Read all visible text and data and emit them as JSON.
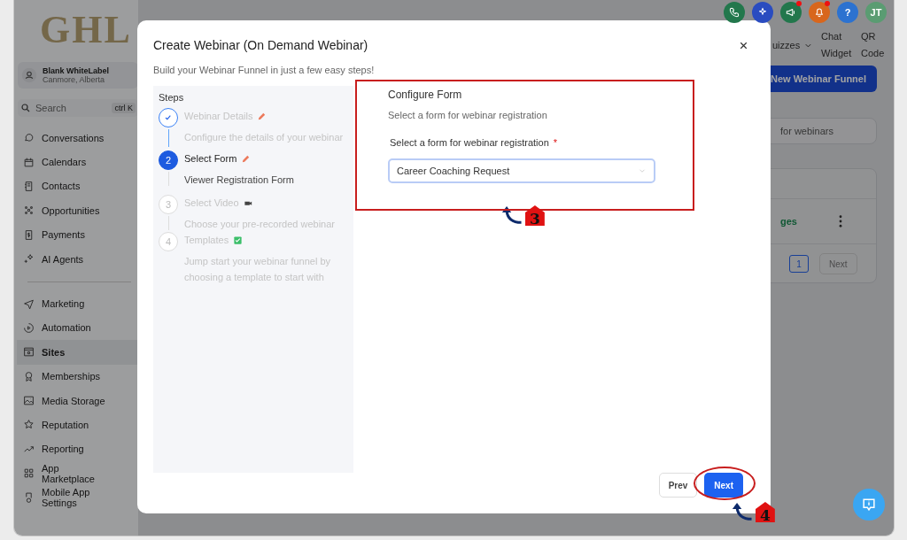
{
  "app": {
    "logo": "GHL",
    "account": {
      "name": "Blank WhiteLabel",
      "location": "Canmore, Alberta"
    },
    "search": {
      "placeholder": "Search",
      "shortcut": "ctrl K"
    },
    "nav_groups": [
      [
        {
          "label": "Conversations",
          "selected": false
        },
        {
          "label": "Calendars",
          "selected": false
        },
        {
          "label": "Contacts",
          "selected": false
        },
        {
          "label": "Opportunities",
          "selected": false
        },
        {
          "label": "Payments",
          "selected": false
        },
        {
          "label": "AI Agents",
          "selected": false
        }
      ],
      [
        {
          "label": "Marketing",
          "selected": false
        },
        {
          "label": "Automation",
          "selected": false
        },
        {
          "label": "Sites",
          "selected": true
        },
        {
          "label": "Memberships",
          "selected": false
        },
        {
          "label": "Media Storage",
          "selected": false
        },
        {
          "label": "Reputation",
          "selected": false
        },
        {
          "label": "Reporting",
          "selected": false
        },
        {
          "label": "App Marketplace",
          "selected": false
        },
        {
          "label": "Mobile App Settings",
          "selected": false
        }
      ]
    ]
  },
  "header": {
    "actions": [
      {
        "kind": "phone",
        "color": "#22774c",
        "badge": false
      },
      {
        "kind": "sparkle",
        "color": "#2a4cc0",
        "badge": false
      },
      {
        "kind": "megaphone",
        "color": "#22774c",
        "badge": true
      },
      {
        "kind": "bell",
        "color": "#d8661c",
        "badge": true
      },
      {
        "kind": "text",
        "label": "?",
        "color": "#2c72d0",
        "badge": false
      },
      {
        "kind": "text",
        "label": "JT",
        "color": "#5a9c72",
        "badge": false
      }
    ],
    "menu": [
      {
        "label": "uizzes",
        "dropdown": true
      },
      {
        "label": "Chat Widget",
        "dropdown": false
      },
      {
        "label": "QR Code",
        "dropdown": false
      }
    ]
  },
  "page": {
    "primary_button": "New Webinar Funnel",
    "search": {
      "placeholder": "for webinars"
    },
    "table": {
      "rows": [
        {
          "column_1": "ges"
        }
      ]
    },
    "pagination": {
      "pages": [
        {
          "label": "1",
          "selected": true
        }
      ],
      "next": "Next"
    }
  },
  "modal": {
    "title": "Create Webinar (On Demand Webinar)",
    "subtitle": "Build your Webinar Funnel in just a few easy steps!",
    "steps_heading": "Steps",
    "steps": [
      {
        "title": "Webinar Details",
        "description": "Configure the details of your webinar",
        "completed": true,
        "selected": false
      },
      {
        "number": "2",
        "title": "Select Form",
        "description": "Viewer Registration Form",
        "completed": false,
        "selected": true
      },
      {
        "number": "3",
        "title": "Select Video",
        "description": "Choose your pre-recorded webinar",
        "completed": false,
        "selected": false
      },
      {
        "number": "4",
        "title": "Templates",
        "description": "Jump start your webinar funnel by choosing a template to start with",
        "completed": false,
        "selected": false
      }
    ],
    "form": {
      "heading": "Configure Form",
      "description": "Select a form for webinar registration",
      "field": {
        "label": "Select a form for webinar registration",
        "required_mark": "*",
        "value": "Career Coaching Request"
      }
    },
    "buttons": {
      "prev": "Prev",
      "next": "Next"
    }
  },
  "annotations": [
    {
      "label": "3"
    },
    {
      "label": "4"
    }
  ]
}
